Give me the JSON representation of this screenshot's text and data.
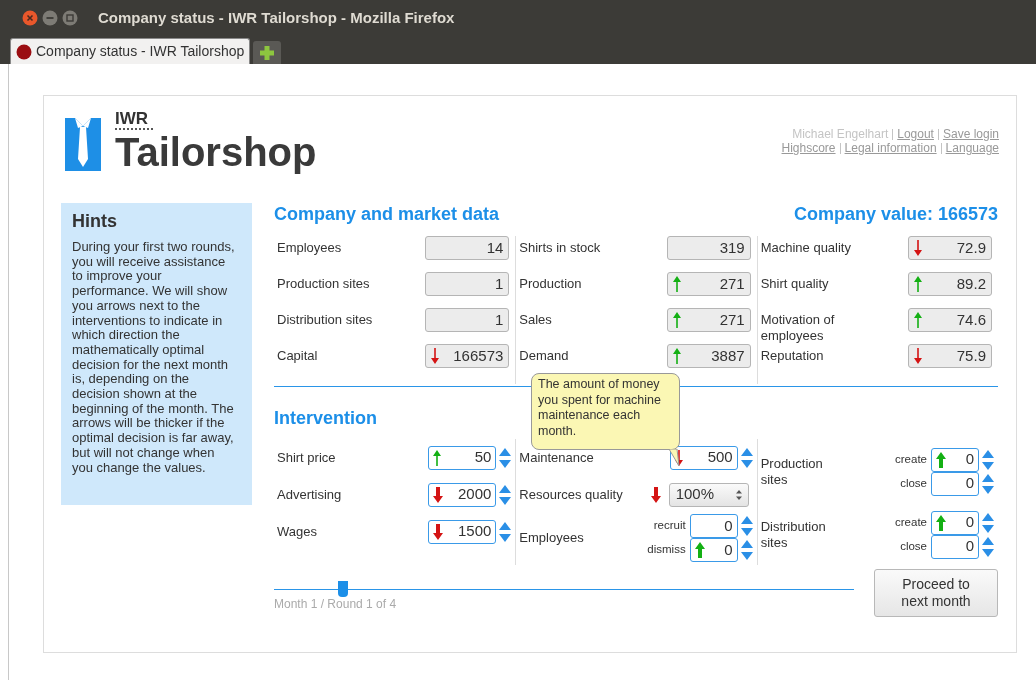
{
  "window": {
    "title": "Company status - IWR Tailorshop - Mozilla Firefox"
  },
  "tabs": [
    {
      "label": "Company status - IWR Tailorshop",
      "selected": true
    }
  ],
  "logo": {
    "small": "IWR",
    "large": "Tailorshop"
  },
  "user_bar": {
    "user": "Michael Engelhart",
    "links": [
      [
        "Logout",
        "Save login"
      ],
      [
        "Highscore",
        "Legal information",
        "Language"
      ]
    ]
  },
  "hints": {
    "title": "Hints",
    "text": "During your first two rounds, you will receive assistance to improve your performance. We will show you arrows next to the interventions to indicate in which direction the mathematically optimal decision for the next month is, depending on the decision shown at the beginning of the month. The arrows will be thicker if the optimal decision is far away, but will not change when you change the values."
  },
  "market": {
    "title": "Company and market data",
    "company_value": "Company value: 166573",
    "columns": [
      [
        {
          "label": "Employees",
          "value": "14"
        },
        {
          "label": "Production sites",
          "value": "1"
        },
        {
          "label": "Distribution sites",
          "value": "1"
        },
        {
          "label": "Capital",
          "value": "166573",
          "up": false,
          "strong": false
        }
      ],
      [
        {
          "label": "Shirts in stock",
          "value": "319"
        },
        {
          "label": "Production",
          "value": "271",
          "up": true,
          "strong": false
        },
        {
          "label": "Sales",
          "value": "271",
          "up": true,
          "strong": false
        },
        {
          "label": "Demand",
          "value": "3887",
          "up": true,
          "strong": false
        }
      ],
      [
        {
          "label": "Machine quality",
          "value": "72.9",
          "up": false,
          "strong": false
        },
        {
          "label": "Shirt quality",
          "value": "89.2",
          "up": true,
          "strong": false
        },
        {
          "label": "Motivation of employees",
          "value": "74.6",
          "up": true,
          "strong": false
        },
        {
          "label": "Reputation",
          "value": "75.9",
          "up": false,
          "strong": false
        }
      ]
    ]
  },
  "intervention": {
    "title": "Intervention",
    "columns": [
      [
        {
          "kind": "spin",
          "label": "Shirt price",
          "value": "50",
          "up": true,
          "strong": false
        },
        {
          "kind": "spin",
          "label": "Advertising",
          "value": "2000",
          "up": false,
          "strong": true
        },
        {
          "kind": "spin",
          "label": "Wages",
          "value": "1500",
          "up": false,
          "strong": true
        }
      ],
      [
        {
          "kind": "spin",
          "label": "Maintenance",
          "value": "500",
          "up": false,
          "strong": false
        },
        {
          "kind": "select",
          "label": "Resources quality",
          "value": "100%",
          "up": false,
          "strong": true
        },
        {
          "kind": "pair",
          "label": "Employees",
          "fields": [
            {
              "label": "recruit",
              "value": "0"
            },
            {
              "label": "dismiss",
              "value": "0",
              "up": true,
              "strong": true
            }
          ]
        }
      ],
      [
        {
          "kind": "pair",
          "label": "Production sites",
          "fields": [
            {
              "label": "create",
              "value": "0",
              "up": true,
              "strong": true
            },
            {
              "label": "close",
              "value": "0"
            }
          ]
        },
        {
          "kind": "pair",
          "label": "Distribution sites",
          "fields": [
            {
              "label": "create",
              "value": "0",
              "up": true,
              "strong": true
            },
            {
              "label": "close",
              "value": "0"
            }
          ]
        }
      ]
    ]
  },
  "tooltip": {
    "text": "The amount of money you spent for machine maintenance each month."
  },
  "progress": {
    "level": 0.11,
    "label": "Month 1 / Round 1 of 4"
  },
  "proceed_button": "Proceed to next month"
}
